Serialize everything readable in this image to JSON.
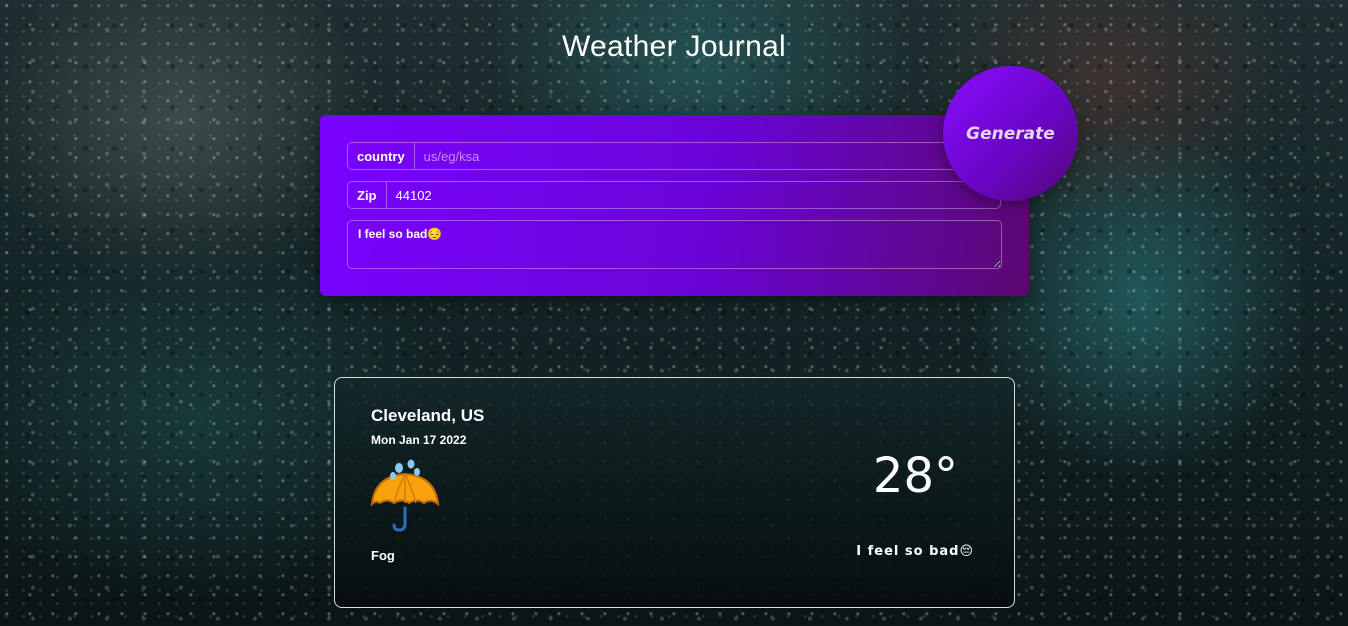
{
  "page": {
    "title": "Weather Journal"
  },
  "form": {
    "country": {
      "label": "country",
      "placeholder": "us/eg/ksa",
      "value": ""
    },
    "zip": {
      "label": "Zip",
      "value": "44102"
    },
    "feelings": {
      "value": "I feel so bad😔"
    },
    "generate_label": "Generate"
  },
  "entry": {
    "city": "Cleveland, US",
    "date": "Mon Jan 17 2022",
    "condition": "Fog",
    "temp": "28°",
    "content": "I feel so bad😔",
    "icon": "umbrella-rain-icon"
  },
  "colors": {
    "form_gradient_start": "#7a03ff",
    "form_gradient_end": "#5a0870",
    "button_text": "#e6d3f2"
  }
}
